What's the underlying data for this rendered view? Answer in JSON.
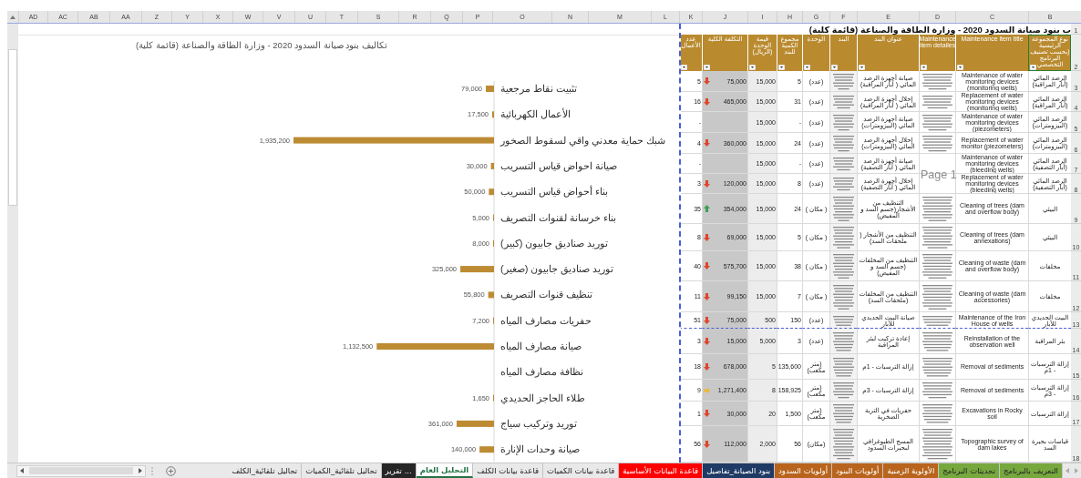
{
  "column_letters": [
    "B",
    "C",
    "D",
    "E",
    "F",
    "G",
    "H",
    "I",
    "J",
    "K",
    "L",
    "M",
    "N",
    "O",
    "P",
    "Q",
    "R",
    "S",
    "T",
    "U",
    "V",
    "W",
    "X",
    "Y",
    "Z",
    "AA",
    "AB",
    "AC",
    "AD"
  ],
  "chart": {
    "chart_data": {
      "type": "bar",
      "orientation": "horizontal",
      "title": "تكاليف بنود صيانة السدود 2020 - وزارة الطاقة والصناعة (قائمة كلية)",
      "data_labels": true,
      "categories": [
        "تثبيت نقاط مرجعية",
        "الأعمال الكهربائية",
        "شبك حماية معدني واقي لسقوط الصخور",
        "صيانة احواض قياس التسريب",
        "بناء أحواض قياس التسريب",
        "بناء خرسانة لقنوات  التصريف",
        "توريد صناديق جابيون (كبير)",
        "توريد صناديق جابيون (صغير)",
        "تنظيف قنوات التصريف",
        "حفريات مصارف المياه",
        "صيانة مصارف المياه",
        "نظافة مصارف المياه",
        "طلاء الحاجز الحديدي",
        "توريد وتركيب سياج",
        "صيانة وحدات الإنارة"
      ],
      "values": [
        79000,
        17500,
        1935200,
        30000,
        50000,
        5000,
        8000,
        325000,
        55800,
        7200,
        1132500,
        null,
        1650,
        361000,
        140000
      ],
      "value_labels": [
        "79,000",
        "17,500",
        "1,935,200",
        "30,000",
        "50,000",
        "5,000",
        "8,000",
        "325,000",
        "55,800",
        "7,200",
        "1,132,500",
        null,
        "1,650",
        "361,000",
        "140,000"
      ]
    }
  },
  "table": {
    "title_row_number": "1",
    "title": "ب بنود صيانة السدود 2020 - وزارة الطاقة والصناعة (قائمة كلية)",
    "header_row_number": "2",
    "columns": [
      {
        "label": "نوع المجموعة الرئيسية (بحسب تصنيف البرنامج التخصصي",
        "selected": true
      },
      {
        "label": "Maintenance item title",
        "selected": false
      },
      {
        "label": "Maintenance item detailes",
        "selected": false
      },
      {
        "label": "عنوان البند",
        "selected": false
      },
      {
        "label": "البند",
        "selected": false
      },
      {
        "label": "الوحدة",
        "selected": false
      },
      {
        "label": "مجموع الكمية للبند",
        "selected": false
      },
      {
        "label": "قيمة الوحدة (الريال)",
        "selected": false
      },
      {
        "label": "التكلفة الكلية",
        "selected": false
      },
      {
        "label": "عدد الأعمال",
        "selected": false
      }
    ],
    "rows": [
      {
        "number": "3",
        "group": "الرصد المائي (آبار المراقبة)",
        "title_en": "Maintenance of water monitoring devices (monitoring wells)",
        "title_ar": "صيانة أجهزة الرصد المائي ( آبار المراقبة)",
        "unit": "(عدد)",
        "quantity": "5",
        "unit_price": "15,000",
        "total": "75,000",
        "kind": "down",
        "count": "5"
      },
      {
        "number": "4",
        "group": "الرصد المائي (آبار المراقبة)",
        "title_en": "Replacement of water monitoring devices (monitoring wells)",
        "title_ar": "إحلال أجهزة الرصد المائي ( آبار المراقبة)",
        "unit": "(عدد)",
        "quantity": "31",
        "unit_price": "15,000",
        "total": "465,000",
        "kind": "down",
        "count": "16"
      },
      {
        "number": "5",
        "group": "الرصد المائي (البيزومترات)",
        "title_en": "Maintenance of water monitoring devices (piezometers)",
        "title_ar": "صيانة أجهزة الرصد المائي (البيزومترات)",
        "unit": "(عدد)",
        "quantity": "-",
        "unit_price": "15,000",
        "count": "-"
      },
      {
        "number": "6",
        "group": "الرصد المائي (البيزومترات)",
        "title_en": "Replacement of water monitor (piezometers)",
        "title_ar": "إحلال أجهزة الرصد المائي (البيزومترات)",
        "unit": "(عدد)",
        "quantity": "24",
        "unit_price": "15,000",
        "total": "360,000",
        "kind": "down",
        "count": "4"
      },
      {
        "number": "7",
        "group": "الرصد المائي (آبار التصفية)",
        "title_en": "Maintenance of water monitoring devices (bleeding wells)",
        "title_ar": "صيانة أجهزة الرصد المائي ( آبار التصفية)",
        "unit": "(عدد)",
        "quantity": "-",
        "unit_price": "15,000",
        "count": "-"
      },
      {
        "number": "8",
        "group": "الرصد المائي (آبار التصفية)",
        "title_en": "Replacement of water monitoring devices (bleeding wells)",
        "title_ar": "إحلال أجهزة الرصد المائي ( آبار التصفية)",
        "unit": "(عدد)",
        "quantity": "8",
        "unit_price": "15,000",
        "total": "120,000",
        "kind": "down",
        "count": "3"
      },
      {
        "number": "9",
        "group": "البيئي",
        "title_en": "Cleaning of trees (dam and overflow body)",
        "title_ar": "التنظيف من الأشجار(جسم السد و المفيض)",
        "unit": "( مكان )",
        "quantity": "24",
        "unit_price": "15,000",
        "total": "354,000",
        "kind": "up",
        "count": "35"
      },
      {
        "number": "10",
        "group": "البيئي",
        "title_en": "Cleaning of trees (dam annexations)",
        "title_ar": "التنظيف من الأشجار ( ملحقات السد)",
        "unit": "( مكان )",
        "quantity": "5",
        "unit_price": "15,000",
        "total": "69,000",
        "kind": "down",
        "count": "8"
      },
      {
        "number": "11",
        "group": "مخلفات",
        "title_en": "Cleaning of waste (dam and overflow body)",
        "title_ar": "التنظيف من المخلفات (جسم السد و المفيض)",
        "unit": "( مكان )",
        "quantity": "38",
        "unit_price": "15,000",
        "total": "575,700",
        "kind": "down",
        "count": "40"
      },
      {
        "number": "12",
        "group": "مخلفات",
        "title_en": "Cleaning of waste (dam accessories)",
        "title_ar": "التنظيف من المخلفات (ملحقات السد)",
        "unit": "( مكان )",
        "quantity": "7",
        "unit_price": "15,000",
        "total": "99,150",
        "kind": "down",
        "count": "11"
      },
      {
        "number": "13",
        "group": "البيت الحديدي للآبار",
        "title_en": "Maintenance of the Iron House of wells",
        "title_ar": "صيانة البيت الحديدي للآبار",
        "unit": "(عدد)",
        "quantity": "150",
        "unit_price": "500",
        "total": "75,000",
        "kind": "down",
        "count": "51"
      },
      {
        "number": "14",
        "group": "بئر المراقبة",
        "title_en": "Reinstallation of the observation well",
        "title_ar": "إعادة تركيب لبئر المراقبة",
        "unit": "(عدد)",
        "quantity": "3",
        "unit_price": "5,000",
        "total": "15,000",
        "kind": "down",
        "count": "3"
      },
      {
        "number": "15",
        "group": "إزالة الترسبات - 1م",
        "title_en": "Removal of sediments",
        "title_ar": "إزالة الترسبات - 1م",
        "unit": "(متر مكعب)",
        "quantity": "135,600",
        "unit_price": "5",
        "total": "678,000",
        "kind": "down",
        "count": "18"
      },
      {
        "number": "16",
        "group": "إزالة الترسبات - 3م",
        "title_en": "Removal of sediments",
        "title_ar": "إزالة الترسبات - 3م",
        "unit": "(متر مكعب)",
        "quantity": "158,925",
        "unit_price": "8",
        "total": "1,271,400",
        "kind": "flat",
        "count": "9"
      },
      {
        "number": "17",
        "group": "إزالة الترسبات",
        "title_en": "Excavations in Rocky soil",
        "title_ar": "حفريات في التربة الصخرية",
        "unit": "(متر مكعب)",
        "quantity": "1,500",
        "unit_price": "20",
        "total": "30,000",
        "kind": "down",
        "count": "1"
      },
      {
        "number": "18",
        "group": "قياسات بحيرة السد",
        "title_en": "Topographic survey of dam lakes",
        "title_ar": "المسح الطبوغرافي لبحيرات السدود",
        "unit": "(مكان)",
        "quantity": "56",
        "unit_price": "2,000",
        "total": "112,000",
        "kind": "down",
        "count": "56"
      }
    ]
  },
  "page_label": "Page 1",
  "sheet_tabs": [
    {
      "label": "التعريف بالبرنامج",
      "color": "#77a83e",
      "selected": false
    },
    {
      "label": "تحديثات البرنامج",
      "color": "#77a83e",
      "selected": false
    },
    {
      "label": "الأولوية الزمنية",
      "color": "#b8641c",
      "selected": false
    },
    {
      "label": "أولويات البنود",
      "color": "#b8641c",
      "selected": false
    },
    {
      "label": "أولويات السدود",
      "color": "#b8641c",
      "selected": false
    },
    {
      "label": "بنود الصيانة_تفاصيل",
      "color": "#1f3a64",
      "selected": false
    },
    {
      "label": "قاعدة البيانات الأساسية",
      "color": "#ff0000",
      "selected": false
    },
    {
      "label": "قاعدة بيانات الكميات",
      "selected": false
    },
    {
      "label": "قاعدة بيانات الكلف",
      "selected": false
    },
    {
      "label": "التحليل العام",
      "selected": true
    },
    {
      "label": "تقرير ...",
      "color": "#262626",
      "selected": false
    },
    {
      "label": "تحاليل تلقائية_الكميات",
      "selected": false
    },
    {
      "label": "تحاليل تلقائية_الكلف",
      "selected": false
    }
  ]
}
